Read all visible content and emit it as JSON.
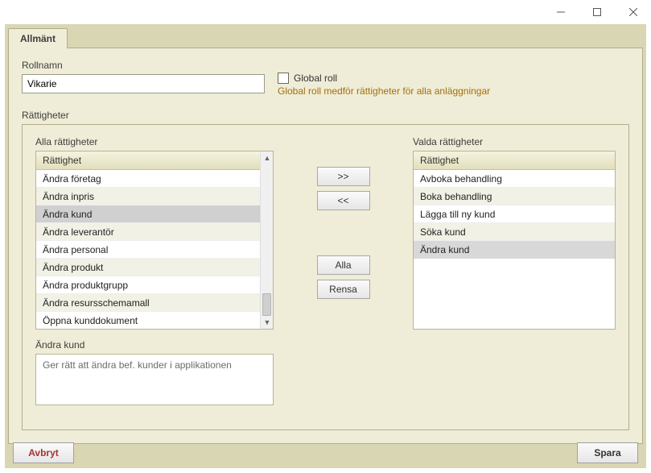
{
  "window": {
    "minimize": "minimize",
    "maximize": "maximize",
    "close": "close"
  },
  "tabs": {
    "general": "Allmänt"
  },
  "role": {
    "label": "Rollnamn",
    "value": "Vikarie"
  },
  "global": {
    "label": "Global roll",
    "hint": "Global roll medför rättigheter för alla anläggningar"
  },
  "rights": {
    "section_label": "Rättigheter",
    "all": {
      "label": "Alla rättigheter",
      "header": "Rättighet",
      "items": [
        "Ändra företag",
        "Ändra inpris",
        "Ändra kund",
        "Ändra leverantör",
        "Ändra personal",
        "Ändra produkt",
        "Ändra produktgrupp",
        "Ändra resursschemamall",
        "Öppna kunddokument"
      ],
      "selected_index": 2
    },
    "selected": {
      "label": "Valda rättigheter",
      "header": "Rättighet",
      "items": [
        "Avboka behandling",
        "Boka behandling",
        "Lägga till ny kund",
        "Söka kund",
        "Ändra kund"
      ],
      "selected_index": 4
    },
    "buttons": {
      "add": ">>",
      "remove": "<<",
      "all": "Alla",
      "clear": "Rensa"
    },
    "description": {
      "label": "Ändra kund",
      "text": "Ger rätt att ändra bef. kunder i applikationen"
    }
  },
  "footer": {
    "cancel": "Avbryt",
    "save": "Spara"
  }
}
